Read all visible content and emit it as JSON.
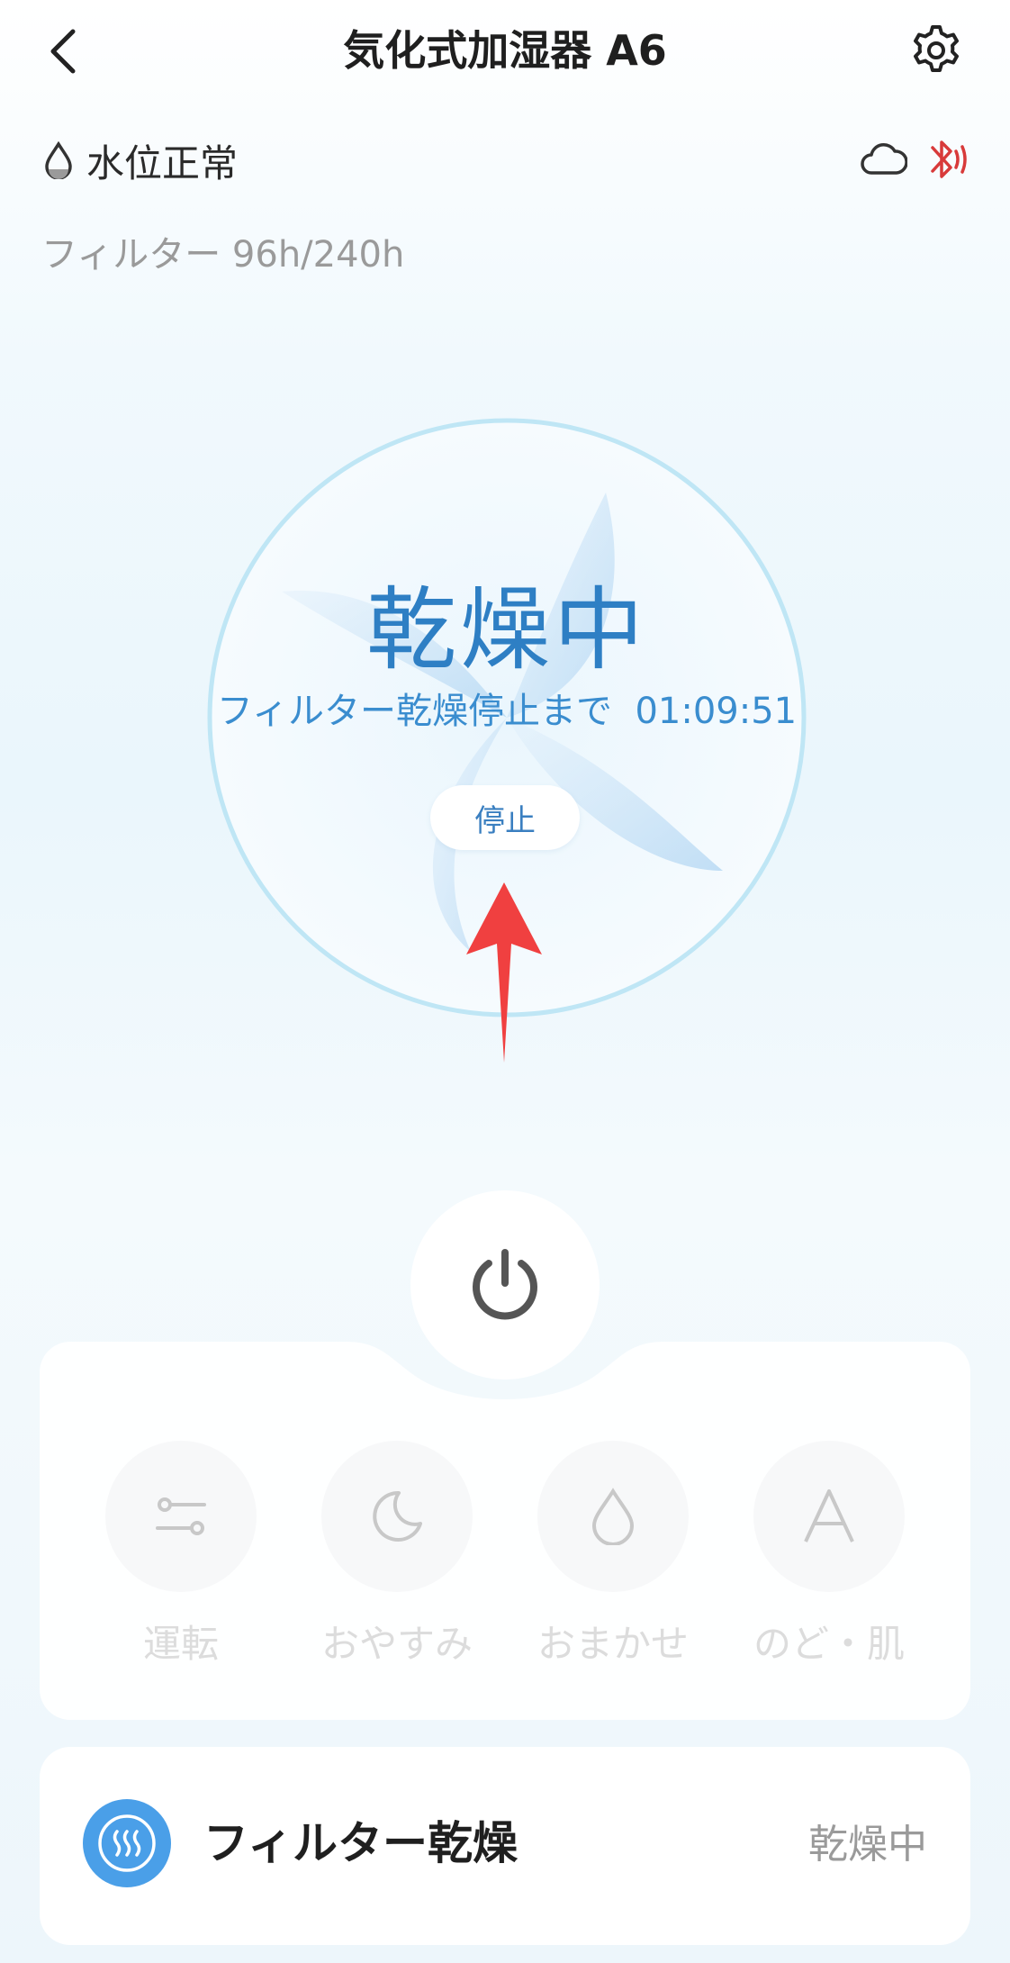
{
  "header": {
    "title": "気化式加湿器 A6"
  },
  "status": {
    "water_level": "水位正常",
    "filter_hours": "フィルター 96h/240h"
  },
  "dial": {
    "state": "乾燥中",
    "countdown_label": "フィルター乾燥停止まで",
    "countdown_time": "01:09:51",
    "stop_label": "停止",
    "accent_color": "#2e7fc4"
  },
  "modes": [
    {
      "label": "運転",
      "icon": "sliders-icon"
    },
    {
      "label": "おやすみ",
      "icon": "moon-icon"
    },
    {
      "label": "おまかせ",
      "icon": "droplet-icon"
    },
    {
      "label": "のど・肌",
      "icon": "letter-a-icon"
    }
  ],
  "filter_dry": {
    "title": "フィルター乾燥",
    "status": "乾燥中",
    "icon_color": "#4a9fe8"
  },
  "indicator": {
    "bluetooth_color": "#d83a3a",
    "arrow_color": "#f04040"
  }
}
